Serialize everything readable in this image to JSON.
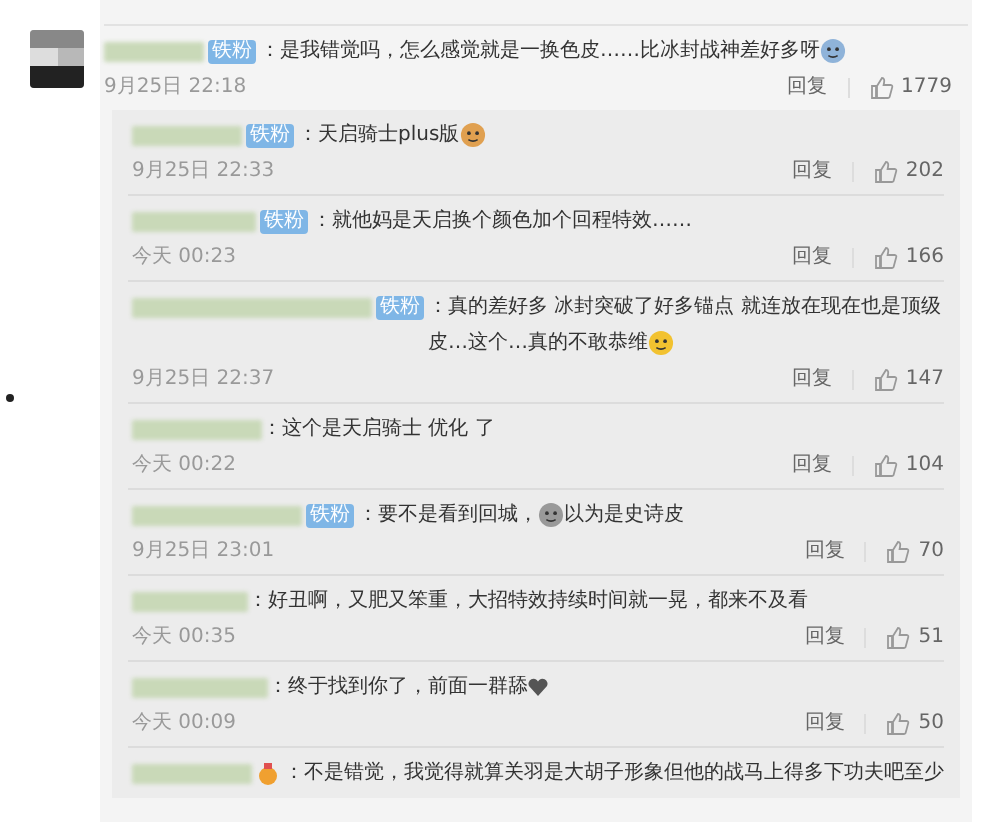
{
  "comment": {
    "badge": {
      "kind": "fan",
      "text": "铁粉"
    },
    "segments": [
      {
        "kind": "text",
        "text": "：是我错觉吗，怎么感觉就是一换色皮……比冰封战神差好多呀"
      },
      {
        "kind": "crying"
      }
    ],
    "time": "9月25日 22:18",
    "reply_label": "回复",
    "likes": "1779"
  },
  "replies": [
    {
      "badge": {
        "kind": "fan",
        "text": "铁粉"
      },
      "segments": [
        {
          "kind": "text",
          "text": "：天启骑士plus版"
        },
        {
          "kind": "cat"
        }
      ],
      "time": "9月25日 22:33",
      "reply_label": "回复",
      "likes": "202"
    },
    {
      "badge": {
        "kind": "fan",
        "text": "铁粉"
      },
      "segments": [
        {
          "kind": "text",
          "text": "：就他妈是天启换个颜色加个回程特效……"
        }
      ],
      "time": "今天 00:23",
      "reply_label": "回复",
      "likes": "166"
    },
    {
      "badge": {
        "kind": "fan",
        "text": "铁粉"
      },
      "segments": [
        {
          "kind": "text",
          "text": "：真的差好多 冰封突破了好多锚点 就连放在现在也是顶级皮…这个…真的不敢恭维"
        },
        {
          "kind": "smirk"
        }
      ],
      "time": "9月25日 22:37",
      "reply_label": "回复",
      "likes": "147"
    },
    {
      "segments": [
        {
          "kind": "text",
          "text": "：这个是天启骑士  优化 了"
        }
      ],
      "time": "今天 00:22",
      "reply_label": "回复",
      "likes": "104"
    },
    {
      "badge": {
        "kind": "fan",
        "text": "铁粉"
      },
      "segments": [
        {
          "kind": "text",
          "text": "：要不是看到回城，"
        },
        {
          "kind": "grin"
        },
        {
          "kind": "text",
          "text": "以为是史诗皮"
        }
      ],
      "time": "9月25日 23:01",
      "reply_label": "回复",
      "likes": "70"
    },
    {
      "segments": [
        {
          "kind": "text",
          "text": "：好丑啊，又肥又笨重，大招特效持续时间就一晃，都来不及看"
        }
      ],
      "time": "今天 00:35",
      "reply_label": "回复",
      "likes": "51"
    },
    {
      "segments": [
        {
          "kind": "text",
          "text": "：终于找到你了，前面一群舔"
        },
        {
          "kind": "heart"
        }
      ],
      "time": "今天 00:09",
      "reply_label": "回复",
      "likes": "50"
    },
    {
      "badge": {
        "kind": "medal"
      },
      "segments": [
        {
          "kind": "text",
          "text": "：不是错觉，我觉得就算关羽是大胡子形象但他的战马上得多下功夫吧至少"
        }
      ]
    }
  ]
}
